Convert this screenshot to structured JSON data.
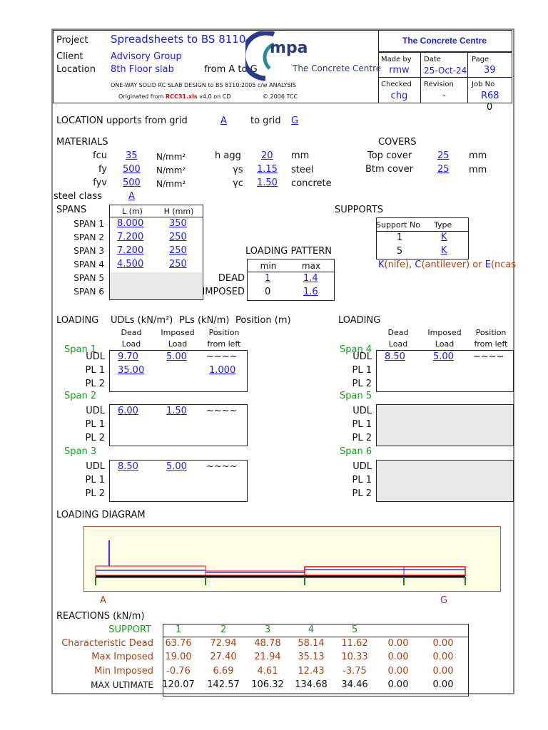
{
  "header": {
    "project_label": "Project",
    "project": "Spreadsheets to BS 8110",
    "client_label": "Client",
    "client": "Advisory Group",
    "location_label": "Location",
    "location": "8th Floor slab",
    "from_to": "from A to G",
    "subtitle": "ONE-WAY SOLID RC SLAB DESIGN to BS 8110:2005 c/w ANALYSIS",
    "orig_prefix": "Originated from",
    "orig_file": "RCC31.xls",
    "orig_version": "v4.0 on CD",
    "copyright": "© 2006 TCC",
    "logo_text": "mpa",
    "logo_sub": "The Concrete Centre",
    "org": "The Concrete Centre",
    "made_by_label": "Made by",
    "made_by": "rmw",
    "date_label": "Date",
    "date": "25-Oct-24",
    "page_label": "Page",
    "page": "39",
    "checked_label": "Checked",
    "checked": "chg",
    "revision_label": "Revision",
    "revision": "-",
    "job_label": "Job No",
    "job": "R68",
    "extra": "0"
  },
  "location": {
    "label": "LOCATION upports from grid",
    "from": "A",
    "to_label": "to grid",
    "to": "G"
  },
  "materials": {
    "title": "MATERIALS",
    "fcu_label": "fcu",
    "fcu": "35",
    "fy_label": "fy",
    "fy": "500",
    "fyv_label": "fyv",
    "fyv": "500",
    "unit": "N/mm²",
    "hagg_label": "h agg",
    "hagg": "20",
    "mm": "mm",
    "gs_label": "γs",
    "gs": "1.15",
    "gs_unit": "steel",
    "gc_label": "γc",
    "gc": "1.50",
    "gc_unit": "concrete",
    "steel_class_label": "steel class",
    "steel_class": "A"
  },
  "covers": {
    "title": "COVERS",
    "top_label": "Top cover",
    "top": "25",
    "btm_label": "Btm cover",
    "btm": "25",
    "unit": "mm"
  },
  "spans": {
    "title": "SPANS",
    "col_l": "L (m)",
    "col_h": "H (mm)",
    "rows": [
      {
        "label": "SPAN 1",
        "l": "8.000",
        "h": "350"
      },
      {
        "label": "SPAN 2",
        "l": "7.200",
        "h": "250"
      },
      {
        "label": "SPAN 3",
        "l": "7.200",
        "h": "250"
      },
      {
        "label": "SPAN 4",
        "l": "4.500",
        "h": "250"
      },
      {
        "label": "SPAN 5",
        "l": "",
        "h": ""
      },
      {
        "label": "SPAN 6",
        "l": "",
        "h": ""
      }
    ]
  },
  "supports": {
    "title": "SUPPORTS",
    "col_no": "Support No",
    "col_type": "Type",
    "rows": [
      {
        "no": "1",
        "type": "K"
      },
      {
        "no": "5",
        "type": "K"
      }
    ],
    "note_k": "K",
    "note_1": "(nife), ",
    "note_c": "C",
    "note_2": "(antilever) or ",
    "note_e": "E",
    "note_3": "(ncas"
  },
  "loading_pattern": {
    "title": "LOADING PATTERN",
    "min": "min",
    "max": "max",
    "dead_label": "DEAD",
    "dead_min": "1",
    "dead_max": "1.4",
    "imposed_label": "IMPOSED",
    "imposed_min": "0",
    "imposed_max": "1.6"
  },
  "loading": {
    "title": "LOADING",
    "udls": "UDLs (kN/m²)",
    "pls": "PLs (kN/m)",
    "position": "Position (m)",
    "h_dead1": "Dead",
    "h_dead2": "Load",
    "h_imp1": "Imposed",
    "h_imp2": "Load",
    "h_pos1": "Position",
    "h_pos2": "from left",
    "udl": "UDL",
    "pl1": "PL 1",
    "pl2": "PL 2",
    "tilde": "~~~~",
    "spans": [
      {
        "label": "Span 1",
        "udl_d": "9.70",
        "udl_i": "5.00",
        "pl1_d": "35.00",
        "pl1_pos": "1.000"
      },
      {
        "label": "Span 2",
        "udl_d": "6.00",
        "udl_i": "1.50"
      },
      {
        "label": "Span 3",
        "udl_d": "8.50",
        "udl_i": "5.00"
      },
      {
        "label": "Span 4",
        "udl_d": "8.50",
        "udl_i": "5.00"
      },
      {
        "label": "Span 5"
      },
      {
        "label": "Span 6"
      }
    ]
  },
  "diagram": {
    "title": "LOADING DIAGRAM",
    "left": "A",
    "right": "G"
  },
  "reactions": {
    "title": "REACTIONS (kN/m)",
    "support_label": "SUPPORT",
    "supports": [
      "1",
      "2",
      "3",
      "4",
      "5",
      "",
      ""
    ],
    "rows": [
      {
        "label": "Characteristic Dead",
        "values": [
          "63.76",
          "72.94",
          "48.78",
          "58.14",
          "11.62",
          "0.00",
          "0.00"
        ]
      },
      {
        "label": "Max Imposed",
        "values": [
          "19.00",
          "27.40",
          "21.94",
          "35.13",
          "10.33",
          "0.00",
          "0.00"
        ]
      },
      {
        "label": "Min Imposed",
        "values": [
          "-0.76",
          "6.69",
          "4.61",
          "12.43",
          "-3.75",
          "0.00",
          "0.00"
        ]
      },
      {
        "label": "MAX ULTIMATE",
        "values": [
          "120.07",
          "142.57",
          "106.32",
          "134.68",
          "34.46",
          "0.00",
          "0.00"
        ]
      }
    ]
  },
  "colors": {
    "link": "#1a1aff",
    "brown": "#b04010",
    "green": "#1a9a1a",
    "diagram_bg": "#fffde6"
  }
}
